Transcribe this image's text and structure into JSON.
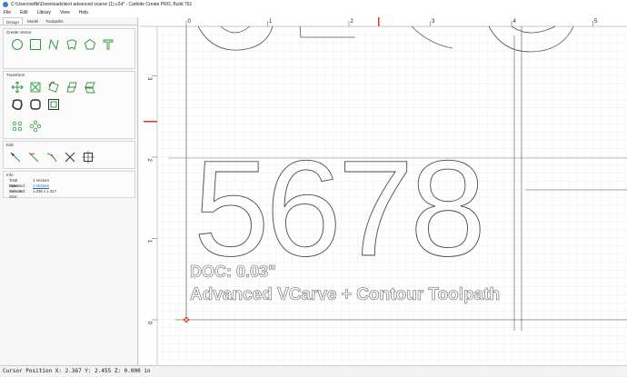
{
  "window": {
    "title": "C:\\Users\\willki\\Downloads\\text advanced vcarve (1).c2d* - Carbide Create PRO, Build 761"
  },
  "menu": {
    "file": "File",
    "edit": "Edit",
    "library": "Library",
    "view": "View",
    "help": "Help"
  },
  "tabs": {
    "design": "Design",
    "model": "Model",
    "toolpaths": "Toolpaths"
  },
  "sections": {
    "create_vector": "Create Vector",
    "transform": "Transform",
    "edit": "Edit",
    "info": "Info"
  },
  "info": {
    "total_selected_label": "Total Selected:",
    "total_selected_value": "1 Vectors",
    "open_selected_label": "Open Selected:",
    "open_selected_value": "1 Vectors",
    "selected_size_label": "Selected Size:",
    "selected_size_value": "1.036 x 1.317"
  },
  "ruler": {
    "top_ticks": [
      "0",
      "1",
      "2",
      "3",
      "4",
      "5"
    ],
    "left_ticks": [
      "3",
      "2",
      "1",
      "0"
    ]
  },
  "canvas_text": {
    "numbers": "5678",
    "doc": "DOC: 0.03\"",
    "desc": "Advanced VCarve + Contour Toolpath"
  },
  "status": {
    "text": "Cursor Position X: 2.367 Y: 2.455 Z: 0.000 in"
  },
  "colors": {
    "accent": "#2e9a3e",
    "marker": "#e0332a",
    "grid": "#d9d9d9"
  }
}
